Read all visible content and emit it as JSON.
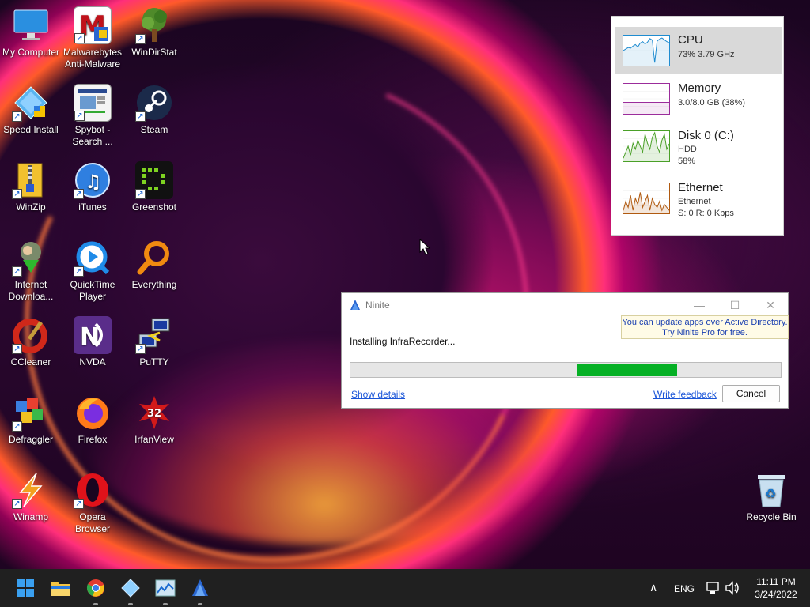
{
  "desktop": {
    "icons": [
      {
        "id": "my-computer",
        "label": "My Computer"
      },
      {
        "id": "malwarebytes",
        "label": "Malwarebytes Anti-Malware"
      },
      {
        "id": "windirstat",
        "label": "WinDirStat"
      },
      {
        "id": "speed-install",
        "label": "Speed Install"
      },
      {
        "id": "spybot",
        "label": "Spybot - Search ..."
      },
      {
        "id": "steam",
        "label": "Steam"
      },
      {
        "id": "winzip",
        "label": "WinZip"
      },
      {
        "id": "itunes",
        "label": "iTunes"
      },
      {
        "id": "greenshot",
        "label": "Greenshot"
      },
      {
        "id": "idm",
        "label": "Internet Downloa..."
      },
      {
        "id": "quicktime",
        "label": "QuickTime Player"
      },
      {
        "id": "everything",
        "label": "Everything"
      },
      {
        "id": "ccleaner",
        "label": "CCleaner"
      },
      {
        "id": "nvda",
        "label": "NVDA"
      },
      {
        "id": "putty",
        "label": "PuTTY"
      },
      {
        "id": "defraggler",
        "label": "Defraggler"
      },
      {
        "id": "firefox",
        "label": "Firefox"
      },
      {
        "id": "irfanview",
        "label": "IrfanView"
      },
      {
        "id": "winamp",
        "label": "Winamp"
      },
      {
        "id": "opera",
        "label": "Opera Browser"
      },
      {
        "id": "recycle-bin",
        "label": "Recycle Bin"
      }
    ]
  },
  "performance": {
    "cpu": {
      "title": "CPU",
      "detail": "73% 3.79 GHz",
      "color": "#1f8cd0",
      "samples": [
        0.5,
        0.55,
        0.6,
        0.58,
        0.65,
        0.7,
        0.62,
        0.75,
        0.8,
        0.72,
        0.78,
        0.9,
        0.85,
        0.1,
        0.82,
        0.88,
        0.92,
        0.86,
        0.8,
        0.76
      ]
    },
    "memory": {
      "title": "Memory",
      "detail": "3.0/8.0 GB (38%)",
      "color": "#9b2c9b",
      "samples": [
        0.38,
        0.38,
        0.38,
        0.38,
        0.38,
        0.38,
        0.38,
        0.38,
        0.38,
        0.38,
        0.38,
        0.38,
        0.38,
        0.38,
        0.38,
        0.38,
        0.38,
        0.38,
        0.38,
        0.38
      ]
    },
    "disk": {
      "title": "Disk 0 (C:)",
      "type": "HDD",
      "detail": "58%",
      "color": "#4aa028",
      "samples": [
        0.1,
        0.3,
        0.5,
        0.2,
        0.6,
        0.4,
        0.7,
        0.5,
        0.3,
        0.9,
        0.6,
        0.4,
        0.8,
        0.95,
        0.5,
        0.3,
        0.7,
        0.9,
        0.4,
        0.58
      ]
    },
    "ethernet": {
      "title": "Ethernet",
      "adapter": "Ethernet",
      "detail": "S: 0  R: 0 Kbps",
      "color": "#b05a10",
      "samples": [
        0.1,
        0.4,
        0.2,
        0.6,
        0.1,
        0.5,
        0.3,
        0.7,
        0.2,
        0.4,
        0.6,
        0.1,
        0.5,
        0.3,
        0.2,
        0.4,
        0.1,
        0.3,
        0.2,
        0.1
      ]
    }
  },
  "ninite": {
    "title": "Ninite",
    "promo_line1": "You can update apps over Active Directory.",
    "promo_line2": "Try Ninite Pro for free.",
    "status": "Installing InfraRecorder...",
    "progress_start": 0.525,
    "progress_end": 0.76,
    "show_details": "Show details",
    "write_feedback": "Write feedback",
    "cancel": "Cancel"
  },
  "taskbar": {
    "language": "ENG",
    "time": "11:11 PM",
    "date": "3/24/2022"
  }
}
